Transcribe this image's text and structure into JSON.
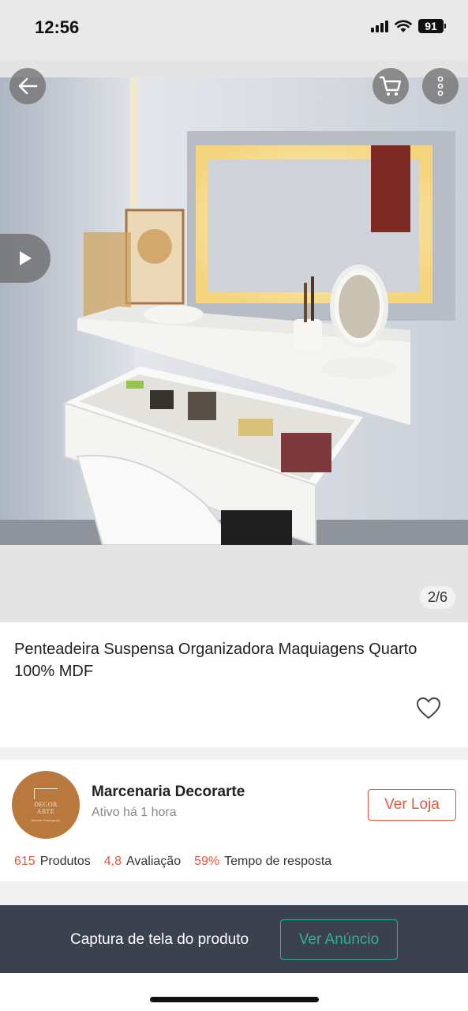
{
  "status_bar": {
    "time": "12:56",
    "battery": "91"
  },
  "gallery": {
    "counter": "2/6"
  },
  "product": {
    "title": "Penteadeira Suspensa Organizadora Maquiagens Quarto 100% MDF"
  },
  "seller": {
    "name": "Marcenaria Decorarte",
    "status": "Ativo há 1 hora",
    "store_button": "Ver Loja",
    "logo_text": [
      "DECOR",
      "ARTE",
      "Móveis Planejados"
    ],
    "stats": [
      {
        "value": "615",
        "label": "Produtos"
      },
      {
        "value": "4,8",
        "label": "Avaliação"
      },
      {
        "value": "59%",
        "label": "Tempo de resposta"
      }
    ]
  },
  "banner": {
    "text": "Captura de tela do produto",
    "button": "Ver Anúncio"
  },
  "colors": {
    "accent": "#e2583e",
    "banner_bg": "#3c4150",
    "banner_accent": "#2bb09a",
    "logo_bg": "#b9783e"
  },
  "icons": [
    "back-arrow-icon",
    "cart-icon",
    "more-vertical-icon",
    "play-icon",
    "heart-icon"
  ]
}
